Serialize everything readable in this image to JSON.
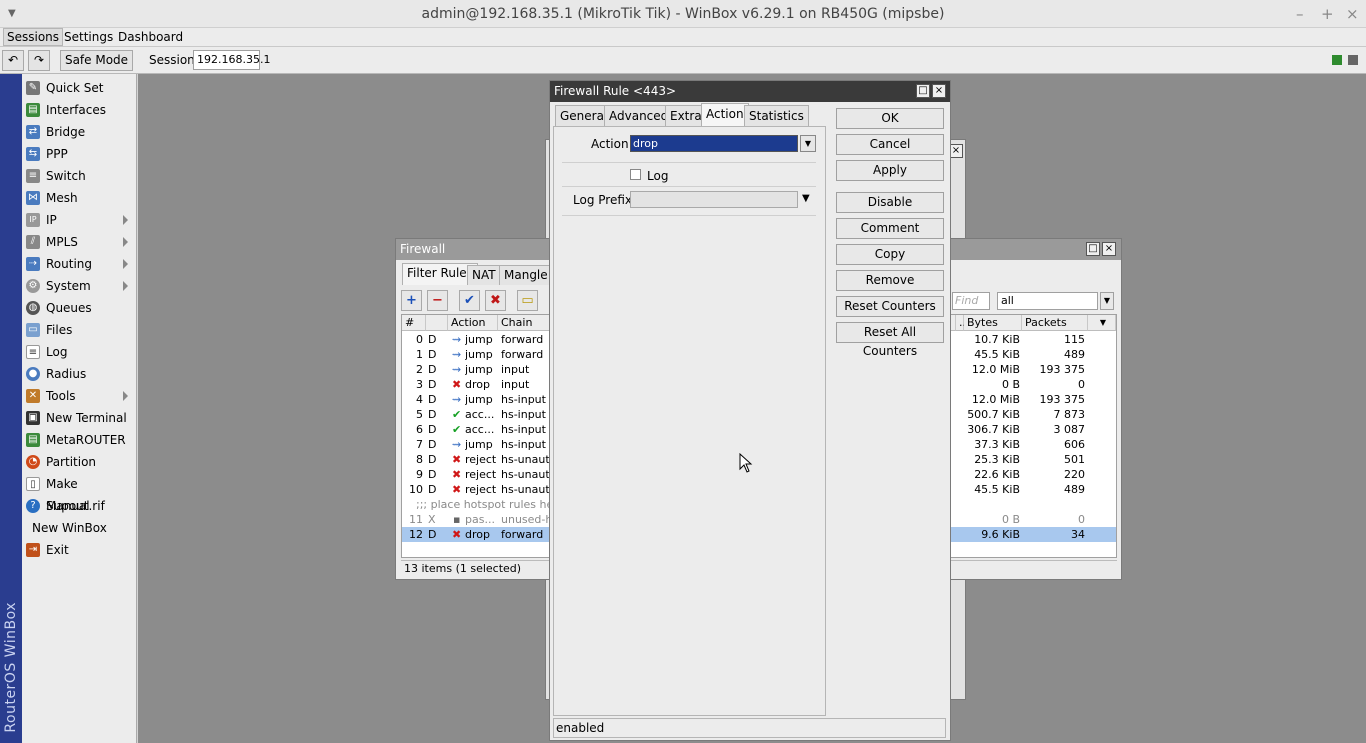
{
  "window": {
    "title": "admin@192.168.35.1 (MikroTik Tik) - WinBox v6.29.1 on RB450G (mipsbe)",
    "minimize": "–",
    "maximize": "+",
    "close": "×"
  },
  "menubar": {
    "sessions": "Sessions",
    "settings": "Settings",
    "dashboard": "Dashboard"
  },
  "toolbar": {
    "undo": "↶",
    "redo": "↷",
    "safe_mode": "Safe Mode",
    "session_label": "Session:",
    "session_value": "192.168.35.1",
    "status_color": "#2e8b2e"
  },
  "rail": {
    "label": "RouterOS WinBox"
  },
  "sidebar": {
    "items": [
      {
        "label": "Quick Set",
        "icon": "quickset-icon"
      },
      {
        "label": "Interfaces",
        "icon": "interfaces-icon"
      },
      {
        "label": "Bridge",
        "icon": "bridge-icon"
      },
      {
        "label": "PPP",
        "icon": "ppp-icon"
      },
      {
        "label": "Switch",
        "icon": "switch-icon"
      },
      {
        "label": "Mesh",
        "icon": "mesh-icon"
      },
      {
        "label": "IP",
        "icon": "ip-icon"
      },
      {
        "label": "MPLS",
        "icon": "mpls-icon"
      },
      {
        "label": "Routing",
        "icon": "routing-icon"
      },
      {
        "label": "System",
        "icon": "system-icon"
      },
      {
        "label": "Queues",
        "icon": "queues-icon"
      },
      {
        "label": "Files",
        "icon": "files-icon"
      },
      {
        "label": "Log",
        "icon": "log-icon"
      },
      {
        "label": "Radius",
        "icon": "radius-icon"
      },
      {
        "label": "Tools",
        "icon": "tools-icon"
      },
      {
        "label": "New Terminal",
        "icon": "terminal-icon"
      },
      {
        "label": "MetaROUTER",
        "icon": "metarouter-icon"
      },
      {
        "label": "Partition",
        "icon": "partition-icon"
      },
      {
        "label": "Make Supout.rif",
        "icon": "supout-icon"
      },
      {
        "label": "Manual",
        "icon": "manual-icon"
      },
      {
        "label": "New WinBox",
        "icon": ""
      },
      {
        "label": "Exit",
        "icon": "exit-icon"
      }
    ]
  },
  "firewall": {
    "title": "Firewall",
    "tabs": [
      "Filter Rules",
      "NAT",
      "Mangle"
    ],
    "filter_value": "all",
    "find_placeholder": "Find",
    "columns": [
      "#",
      "",
      "Action",
      "Chain",
      "..",
      "Bytes",
      "Packets"
    ],
    "rows": [
      {
        "num": "0",
        "flag": "D",
        "action": "jump",
        "chain": "forward",
        "bytes": "10.7 KiB",
        "packets": "115"
      },
      {
        "num": "1",
        "flag": "D",
        "action": "jump",
        "chain": "forward",
        "bytes": "45.5 KiB",
        "packets": "489"
      },
      {
        "num": "2",
        "flag": "D",
        "action": "jump",
        "chain": "input",
        "bytes": "12.0 MiB",
        "packets": "193 375"
      },
      {
        "num": "3",
        "flag": "D",
        "action": "drop",
        "chain": "input",
        "bytes": "0 B",
        "packets": "0"
      },
      {
        "num": "4",
        "flag": "D",
        "action": "jump",
        "chain": "hs-input",
        "bytes": "12.0 MiB",
        "packets": "193 375"
      },
      {
        "num": "5",
        "flag": "D",
        "action": "acc...",
        "chain": "hs-input",
        "bytes": "500.7 KiB",
        "packets": "7 873"
      },
      {
        "num": "6",
        "flag": "D",
        "action": "acc...",
        "chain": "hs-input",
        "bytes": "306.7 KiB",
        "packets": "3 087"
      },
      {
        "num": "7",
        "flag": "D",
        "action": "jump",
        "chain": "hs-input",
        "bytes": "37.3 KiB",
        "packets": "606"
      },
      {
        "num": "8",
        "flag": "D",
        "action": "reject",
        "chain": "hs-unauth",
        "bytes": "25.3 KiB",
        "packets": "501"
      },
      {
        "num": "9",
        "flag": "D",
        "action": "reject",
        "chain": "hs-unauth",
        "bytes": "22.6 KiB",
        "packets": "220"
      },
      {
        "num": "10",
        "flag": "D",
        "action": "reject",
        "chain": "hs-unauth",
        "bytes": "45.5 KiB",
        "packets": "489"
      }
    ],
    "comment_row": ";;; place hotspot rules here",
    "disabled_row": {
      "num": "11",
      "flag": "X",
      "action": "pas...",
      "chain": "unused-hs-chain",
      "bytes": "0 B",
      "packets": "0"
    },
    "selected_row": {
      "num": "12",
      "flag": "D",
      "action": "drop",
      "chain": "forward",
      "bytes": "9.6 KiB",
      "packets": "34"
    },
    "status": "13 items (1 selected)"
  },
  "dialog": {
    "title": "Firewall Rule <443>",
    "tabs": [
      "General",
      "Advanced",
      "Extra",
      "Action",
      "Statistics"
    ],
    "action_label": "Action",
    "action_value": "drop",
    "log_label": "Log",
    "log_checked": false,
    "log_prefix_label": "Log Prefix",
    "log_prefix_value": "",
    "buttons": [
      "OK",
      "Cancel",
      "Apply",
      "Disable",
      "Comment",
      "Copy",
      "Remove",
      "Reset Counters",
      "Reset All Counters"
    ],
    "status": "enabled"
  }
}
